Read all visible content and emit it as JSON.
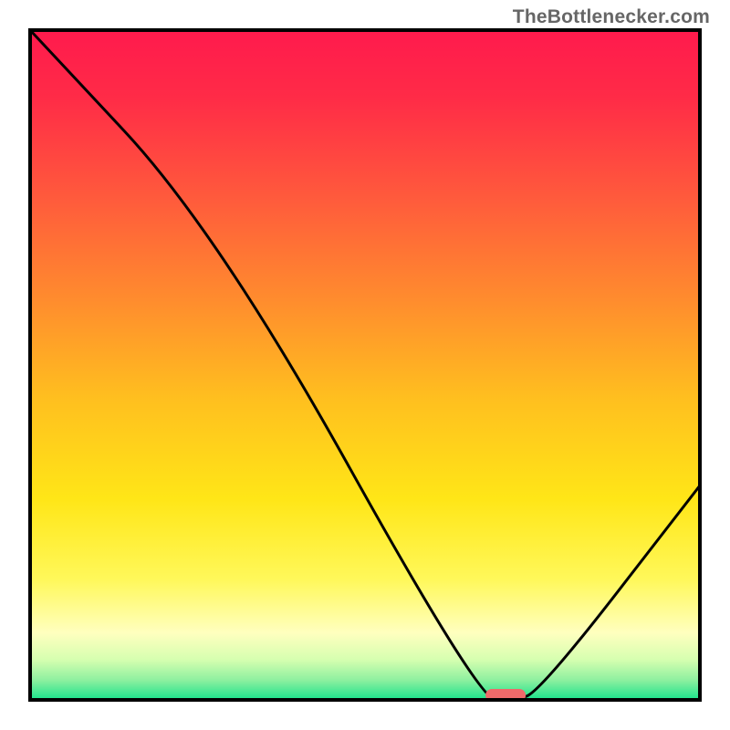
{
  "attribution": "TheBottlenecker.com",
  "chart_data": {
    "type": "line",
    "title": "",
    "xlabel": "",
    "ylabel": "",
    "xlim": [
      0,
      100
    ],
    "ylim": [
      0,
      100
    ],
    "series": [
      {
        "name": "curve",
        "color": "#000000",
        "x": [
          0,
          28,
          67,
          72,
          76,
          100
        ],
        "values": [
          100,
          70,
          0,
          0,
          1,
          32
        ]
      }
    ],
    "marker": {
      "name": "optimum",
      "shape": "capsule",
      "color": "#ee6a6a",
      "x_center": 71,
      "width_pct": 6,
      "y": 0
    },
    "background_gradient": {
      "type": "vertical",
      "stops": [
        {
          "offset": 0.0,
          "color": "#ff1a4d"
        },
        {
          "offset": 0.1,
          "color": "#ff2b47"
        },
        {
          "offset": 0.25,
          "color": "#ff5a3c"
        },
        {
          "offset": 0.4,
          "color": "#ff8b2e"
        },
        {
          "offset": 0.55,
          "color": "#ffbf1f"
        },
        {
          "offset": 0.7,
          "color": "#ffe617"
        },
        {
          "offset": 0.82,
          "color": "#fff85a"
        },
        {
          "offset": 0.9,
          "color": "#ffffbf"
        },
        {
          "offset": 0.94,
          "color": "#d6ffb0"
        },
        {
          "offset": 0.97,
          "color": "#8ff0a0"
        },
        {
          "offset": 1.0,
          "color": "#19e28b"
        }
      ]
    },
    "frame": {
      "color": "#000000",
      "width": 4
    }
  }
}
